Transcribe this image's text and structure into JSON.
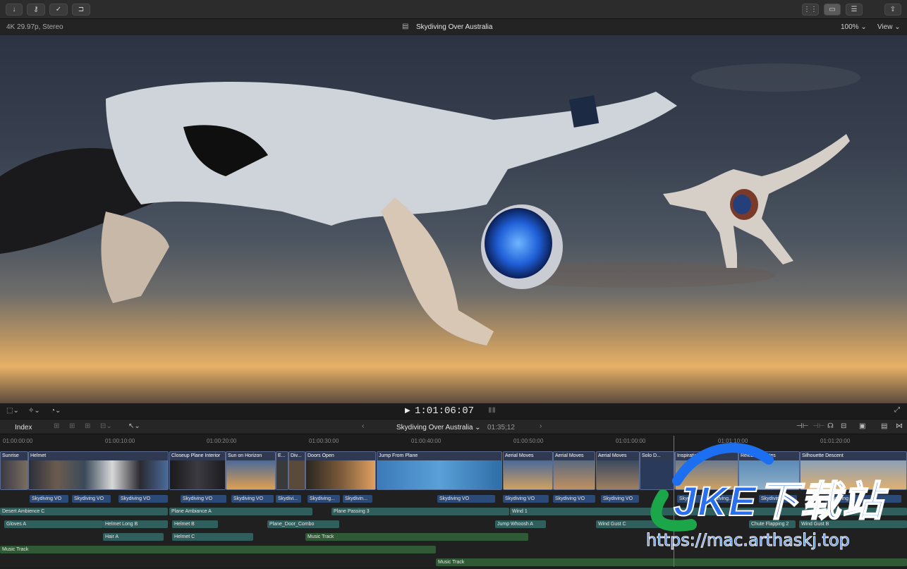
{
  "toolbar": {
    "icons": [
      "import-icon",
      "keywords-icon",
      "background-tasks-icon",
      "share-clip-icon"
    ],
    "right_icons": [
      "browser-grid-icon",
      "timeline-view-icon",
      "inspector-icon",
      "share-icon"
    ]
  },
  "viewer": {
    "format": "4K 29.97p, Stereo",
    "title": "Skydiving Over Australia",
    "zoom": "100%",
    "view_label": "View"
  },
  "controls": {
    "timecode": "1:01:06:07"
  },
  "timeline_bar": {
    "index_label": "Index",
    "project_name": "Skydiving Over Australia",
    "duration": "01:35;12"
  },
  "ruler": {
    "ticks": [
      "01:00:00:00",
      "01:00:10:00",
      "01:00:20:00",
      "01:00:30:00",
      "01:00:40:00",
      "01:00:50:00",
      "01:01:00:00",
      "01:01:10:00",
      "01:01:20:00"
    ]
  },
  "clips": [
    {
      "label": "Sunrise"
    },
    {
      "label": "Helmet"
    },
    {
      "label": "Closeup Plane Interior"
    },
    {
      "label": "Sun on Horizon"
    },
    {
      "label": "E..."
    },
    {
      "label": "Div..."
    },
    {
      "label": "Doors Open"
    },
    {
      "label": "Jump From Plane"
    },
    {
      "label": "Aerial Moves"
    },
    {
      "label": "Aerial Moves"
    },
    {
      "label": "Aerial Moves"
    },
    {
      "label": "Solo D..."
    },
    {
      "label": "Inspiration"
    },
    {
      "label": "Release Chutes"
    },
    {
      "label": "Silhouette Descent"
    }
  ],
  "voiceover": [
    "Skydiving VO",
    "Skydiving VO",
    "Skydiving VO",
    "Skydiving VO",
    "Skydiving VO",
    "Skydivi...",
    "Skydiving...",
    "Skydivin...",
    "Skydiving VO",
    "Skydiving VO",
    "Skydiving VO",
    "Skydiving VO",
    "Skydi...",
    "Skydiving...",
    "Skydiving VO",
    "Skydiving"
  ],
  "audio_row1": [
    "Desert Ambience C",
    "Plane Ambiance A",
    "Plane Passing 3",
    "Wind 1"
  ],
  "audio_row2": [
    "Gloves A",
    "Helmet Long B",
    "Helmet B",
    "Plane_Door_Combo",
    "Jump Whoosh A",
    "Wind Gust C",
    "Chute Flapping 2",
    "Wind Gust B"
  ],
  "audio_row3": [
    "Hair A",
    "Helmet C",
    "Music Track"
  ],
  "music_row1": [
    "Music Track"
  ],
  "music_row2": [
    "Music Track"
  ],
  "watermark": {
    "brand": "JKE下载站",
    "url": "https://mac.arthaskj.top"
  }
}
